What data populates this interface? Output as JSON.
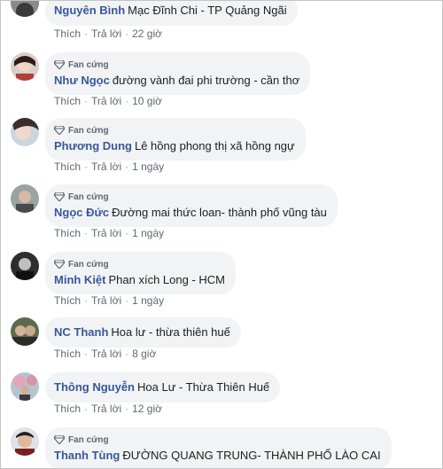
{
  "badge_label": "Fan cứng",
  "actions": {
    "like": "Thích",
    "reply": "Trả lời",
    "separator": "·"
  },
  "comments": [
    {
      "name": "Nguyên Bình",
      "text": "Mạc Đĩnh Chi - TP Quảng Ngãi",
      "time": "22 giờ",
      "badge": false
    },
    {
      "name": "Như Ngọc",
      "text": "đường vành đai phi trường - cần thơ",
      "time": "10 giờ",
      "badge": true
    },
    {
      "name": "Phương Dung",
      "text": "Lê hồng phong thị xã hồng ngự",
      "time": "1 ngày",
      "badge": true
    },
    {
      "name": "Ngọc Đức",
      "text": "Đường mai thức loan- thành phố vũng tàu",
      "time": "1 ngày",
      "badge": true
    },
    {
      "name": "Minh Kiệt",
      "text": "Phan xích Long - HCM",
      "time": "1 ngày",
      "badge": true
    },
    {
      "name": "NC Thanh",
      "text": "Hoa lư - thừa thiên huế",
      "time": "8 giờ",
      "badge": false
    },
    {
      "name": "Thông Nguyễn",
      "text": "Hoa Lư - Thừa Thiên Huế",
      "time": "12 giờ",
      "badge": false
    },
    {
      "name": "Thanh Tùng",
      "text": "ĐƯỜNG QUANG TRUNG- THÀNH PHỐ LÀO CAI",
      "time": "",
      "badge": true
    }
  ]
}
